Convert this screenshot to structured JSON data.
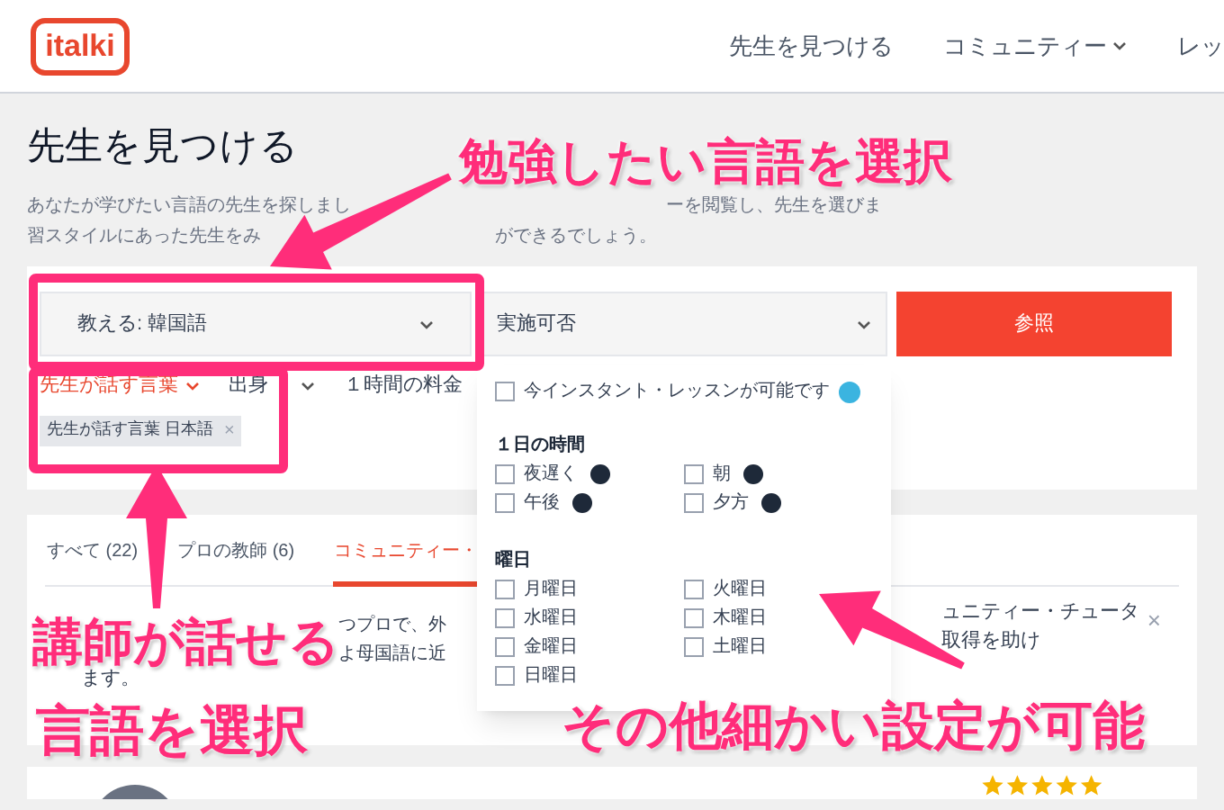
{
  "header": {
    "logo": "italki",
    "nav": [
      {
        "label": "先生を見つける",
        "dropdown": false
      },
      {
        "label": "コミュニティー",
        "dropdown": true
      },
      {
        "label": "レッ",
        "dropdown": false
      }
    ]
  },
  "page_title": "先生を見つける",
  "description_lines": [
    [
      "あなたが学びたい言語の先生を探しまし",
      "ーを閲覧し、先生を選びま"
    ],
    [
      "習スタイルにあった先生をみ",
      "ができるでしょう。"
    ]
  ],
  "search": {
    "language_select": "教える: 韓国語",
    "availability_select": "実施可否",
    "button": "参照"
  },
  "filters": [
    {
      "label": "先生が話す言葉",
      "selected": true,
      "dropdown": true
    },
    {
      "label": "出身",
      "selected": false,
      "dropdown": true
    },
    {
      "label": "１時間の料金",
      "selected": false,
      "dropdown": false
    }
  ],
  "active_tags": [
    {
      "label": "先生が話す言葉 日本語",
      "remove": "×"
    }
  ],
  "availability_panel": {
    "instant": {
      "label": "今インスタント・レッスンが可能です",
      "checked": false
    },
    "time_heading": "１日の時間",
    "times": [
      {
        "label": "夜遅く",
        "checked": false
      },
      {
        "label": "朝",
        "checked": false
      },
      {
        "label": "午後",
        "checked": false
      },
      {
        "label": "夕方",
        "checked": false
      }
    ],
    "day_heading": "曜日",
    "days": [
      {
        "label": "月曜日",
        "checked": false
      },
      {
        "label": "火曜日",
        "checked": false
      },
      {
        "label": "水曜日",
        "checked": false
      },
      {
        "label": "木曜日",
        "checked": false
      },
      {
        "label": "金曜日",
        "checked": false
      },
      {
        "label": "土曜日",
        "checked": false
      },
      {
        "label": "日曜日",
        "checked": false
      }
    ]
  },
  "tabs": [
    {
      "label": "すべて (22)",
      "selected": false
    },
    {
      "label": "プロの教師 (6)",
      "selected": false
    },
    {
      "label": "コミュニティー・",
      "selected": true
    }
  ],
  "notice": {
    "left_lines": [
      "つプロで、外",
      "よ母国語に近"
    ],
    "last_line": "ます。",
    "right_lines": [
      "ュニティー・チュータ",
      "取得を助け"
    ],
    "close": "×"
  },
  "teacher": {
    "stars": 5
  },
  "annotations": [
    {
      "text": "勉強したい言語を選択"
    },
    {
      "text": "講師が話せる"
    },
    {
      "text": "言語を選択"
    },
    {
      "text": "その他細かい設定が可能"
    }
  ]
}
